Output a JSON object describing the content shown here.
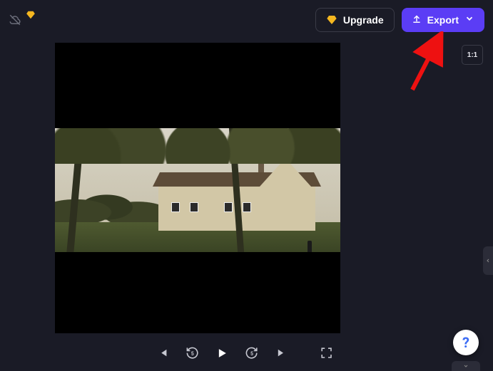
{
  "topbar": {
    "upgrade_label": "Upgrade",
    "export_label": "Export"
  },
  "aspect": {
    "ratio_label": "1:1"
  },
  "controls": {
    "back5": "5",
    "fwd5": "5"
  },
  "help": {
    "label": "?"
  }
}
